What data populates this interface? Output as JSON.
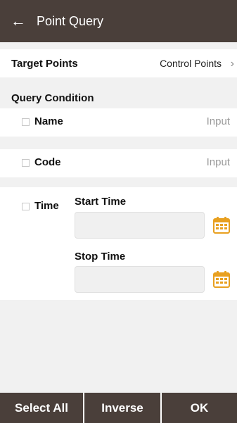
{
  "header": {
    "back_icon": "arrow-left-icon",
    "title": "Point Query"
  },
  "target": {
    "label": "Target Points",
    "value": "Control Points",
    "chevron": "›"
  },
  "query": {
    "section_title": "Query Condition",
    "name": {
      "label": "Name",
      "placeholder": "Input",
      "checked": false
    },
    "code": {
      "label": "Code",
      "placeholder": "Input",
      "checked": false
    },
    "time": {
      "label": "Time",
      "checked": false,
      "start_label": "Start Time",
      "stop_label": "Stop Time",
      "start_value": "",
      "stop_value": ""
    }
  },
  "colors": {
    "header_bg": "#4a3f3a",
    "calendar_accent": "#e8a020",
    "band_bg": "#f1f1f1"
  },
  "bottom_bar": {
    "select_all": "Select All",
    "inverse": "Inverse",
    "ok": "OK"
  }
}
